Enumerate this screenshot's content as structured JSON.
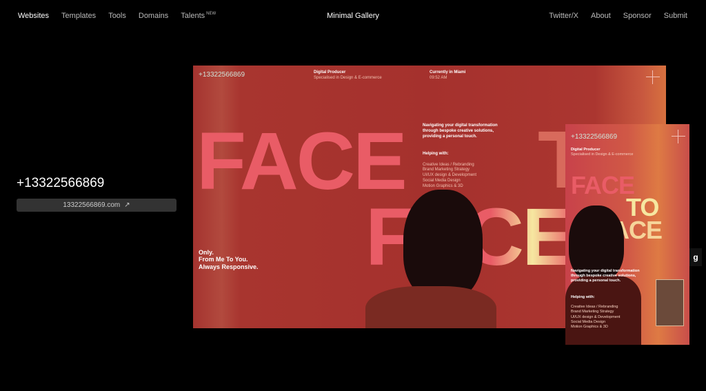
{
  "nav": {
    "left": [
      "Websites",
      "Templates",
      "Tools",
      "Domains",
      "Talents"
    ],
    "new_badge": "NEW",
    "title": "Minimal Gallery",
    "right": [
      "Twitter/X",
      "About",
      "Sponsor",
      "Submit"
    ]
  },
  "site": {
    "title": "+13322566869",
    "link_label": "13322566869.com",
    "link_icon": "arrow-up-right-icon"
  },
  "preview": {
    "phone": "+13322566869",
    "role": "Digital Producer",
    "role_sub": "Specialised in Design & E-commerce",
    "location": "Currently in Miami",
    "time": "09:52 AM",
    "intro": "Navigating your digital transformation through bespoke creative solutions, providing a personal touch.",
    "helping_title": "Helping with:",
    "helping": [
      "Creative Ideas / Rebranding",
      "Brand Marketing Strategy",
      "UI/UX design & Development",
      "Social Media Design",
      "Motion Graphics & 3D"
    ],
    "headline1": "FACE",
    "headline2": "TO",
    "headline3": "FACE",
    "tagline": [
      "Only.",
      "From Me To You.",
      "Always Responsive."
    ]
  },
  "badge": "g",
  "colors": {
    "accent": "#e95c66",
    "bg": "#000000",
    "highlight": "#f6e7a0"
  }
}
